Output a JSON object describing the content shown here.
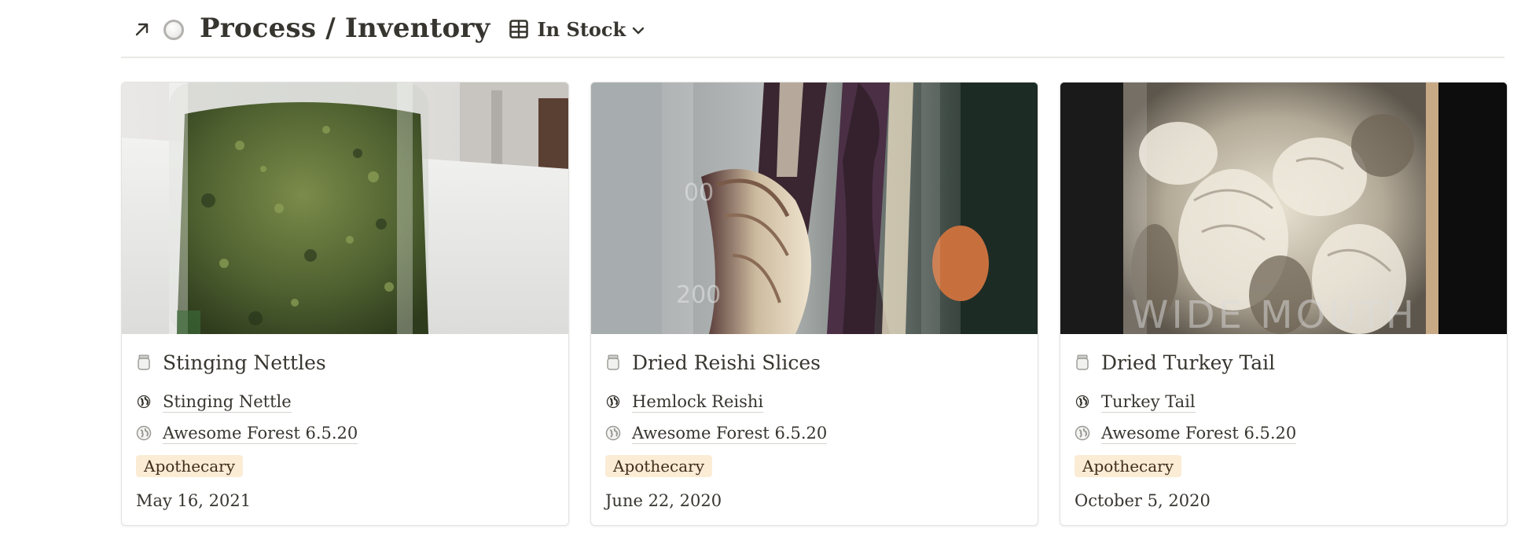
{
  "header": {
    "title": "Process / Inventory",
    "view_label": "In Stock",
    "icons": {
      "open": "arrow-up-right-icon",
      "page": "circle-icon",
      "view": "gallery-view-icon",
      "dropdown": "chevron-down-icon"
    }
  },
  "cards": [
    {
      "title": "Stinging Nettles",
      "species": "Stinging Nettle",
      "source": "Awesome Forest 6.5.20",
      "tag": "Apothecary",
      "date": "May 16, 2021",
      "cover": "glass jar of dried green nettle leaves"
    },
    {
      "title": "Dried Reishi Slices",
      "species": "Hemlock Reishi",
      "source": "Awesome Forest 6.5.20",
      "tag": "Apothecary",
      "date": "June 22, 2020",
      "cover": "glass jar of dried reishi mushroom slices"
    },
    {
      "title": "Dried Turkey Tail",
      "species": "Turkey Tail",
      "source": "Awesome Forest 6.5.20",
      "tag": "Apothecary",
      "date": "October 5, 2020",
      "cover": "glass jar of dried turkey tail mushrooms"
    }
  ],
  "colors": {
    "tag_background": "#fbecd5",
    "text": "#37352f",
    "border": "#e3e2df"
  }
}
